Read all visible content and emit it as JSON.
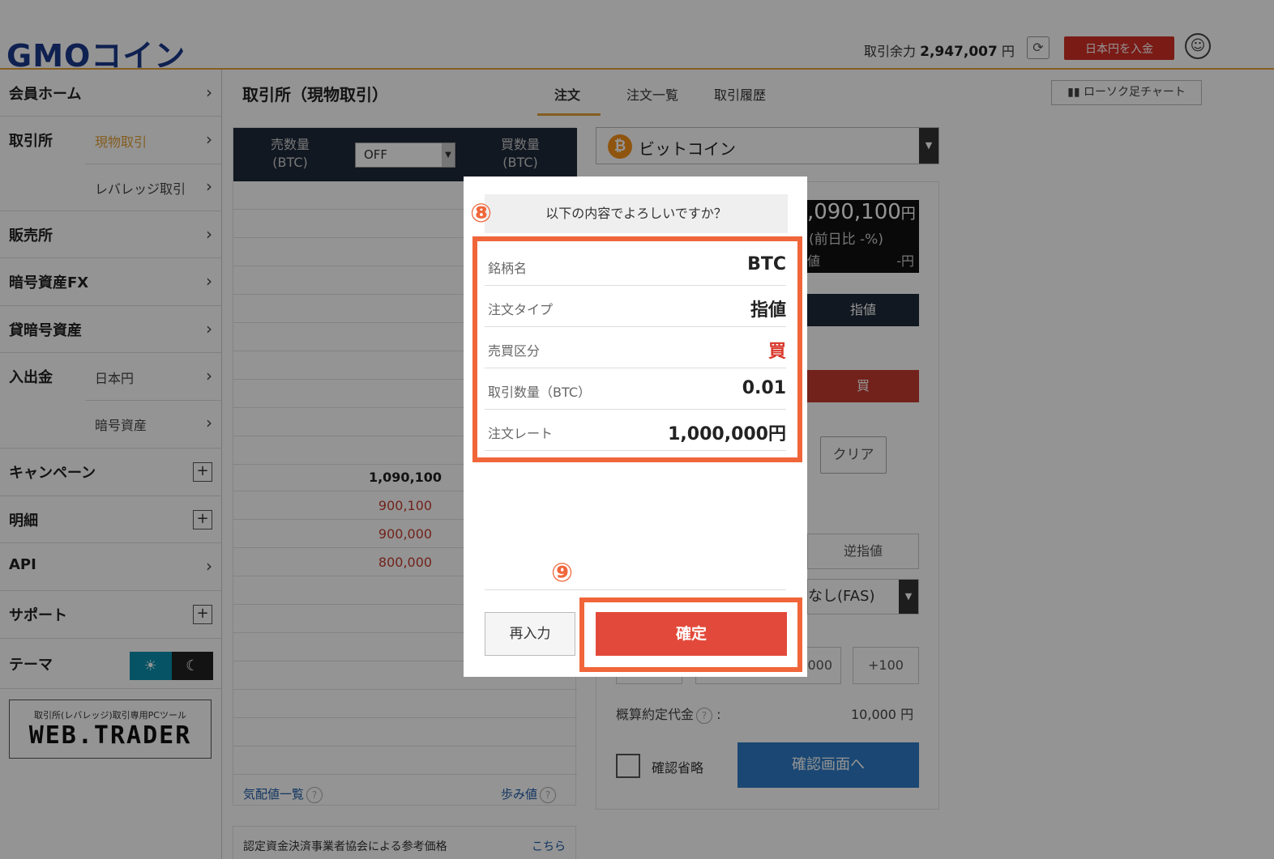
{
  "header": {
    "logo": "GMOコイン",
    "available_label": "取引余力",
    "available_value": "2,947,007",
    "available_unit": "円",
    "deposit_button": "日本円を入金"
  },
  "sidebar": {
    "items": [
      {
        "label": "会員ホーム"
      },
      {
        "label": "取引所",
        "sub": "現物取引"
      },
      {
        "sub": "レバレッジ取引"
      },
      {
        "label": "販売所"
      },
      {
        "label": "暗号資産FX"
      },
      {
        "label": "貸暗号資産"
      },
      {
        "label": "入出金",
        "sub": "日本円"
      },
      {
        "sub": "暗号資産"
      },
      {
        "label": "キャンペーン"
      },
      {
        "label": "明細"
      },
      {
        "label": "API"
      },
      {
        "label": "サポート"
      },
      {
        "label": "テーマ"
      }
    ],
    "webtrader_caption": "取引所(レバレッジ)取引専用PCツール",
    "webtrader_logo": "WEB.TRADER"
  },
  "main": {
    "title": "取引所（現物取引）",
    "tabs": [
      "注文",
      "注文一覧",
      "取引履歴"
    ],
    "chart_button": "ローソク足チャート"
  },
  "orderbook": {
    "sell_qty": "売数量",
    "sell_unit": "(BTC)",
    "buy_qty": "買数量",
    "buy_unit": "(BTC)",
    "filter_value": "OFF",
    "mid_price": "1,090,100",
    "asks": [
      "900,100",
      "900,000",
      "800,000"
    ],
    "quotes_link": "気配値一覧",
    "trades_link": "歩み値",
    "reference_text": "認定資金決済事業者協会による参考価格",
    "reference_link": "こちら"
  },
  "order": {
    "coin": "ビットコイン",
    "ticker_price": ",090,100",
    "ticker_unit": "円",
    "ticker_change": "(前日比 -%)",
    "ticker_low_label": "値",
    "ticker_low_value": "-円",
    "type_limit": "指値",
    "side_buy": "買",
    "clear": "クリア",
    "stop": "逆指値",
    "tif": "なし(FAS)",
    "step_value": "000",
    "step_plus": "+100",
    "estimate_label": "概算約定代金",
    "estimate_colon": ":",
    "estimate_value": "10,000 円",
    "skip_label": "確認省略",
    "confirm_screen": "確認画面へ"
  },
  "dialog": {
    "step8": "⑧",
    "step9": "⑨",
    "question": "以下の内容でよろしいですか？",
    "rows": [
      {
        "key": "銘柄名",
        "value": "BTC"
      },
      {
        "key": "注文タイプ",
        "value": "指値"
      },
      {
        "key": "売買区分",
        "value": "買"
      },
      {
        "key": "取引数量（BTC）",
        "value": "0.01"
      },
      {
        "key": "注文レート",
        "value": "1,000,000円"
      }
    ],
    "reenter": "再入力",
    "confirm": "確定"
  },
  "colors": {
    "accent": "#e3a33a",
    "buy_red": "#c43c2f",
    "annotation": "#f0663a",
    "confirm": "#e2493a",
    "navy": "#1e2a3a"
  }
}
